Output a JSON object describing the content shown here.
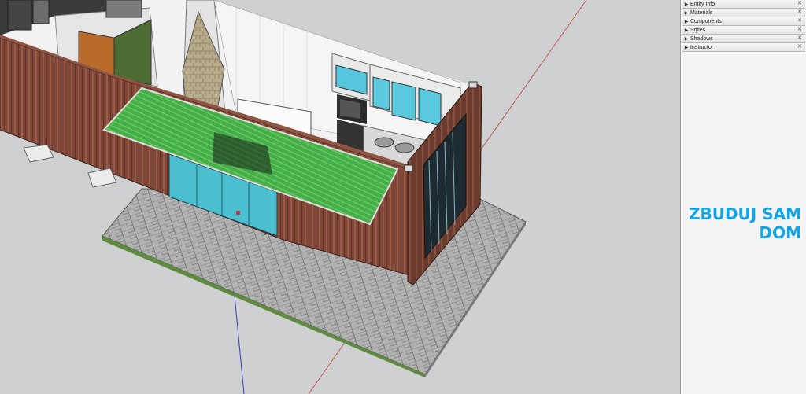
{
  "tray": {
    "items": [
      {
        "label": "Entity Info"
      },
      {
        "label": "Materials"
      },
      {
        "label": "Components"
      },
      {
        "label": "Styles"
      },
      {
        "label": "Shadows"
      },
      {
        "label": "Instructor"
      }
    ],
    "expand_icon": "triangle-right-icon",
    "close_icon": "close-icon"
  },
  "watermark": {
    "line1": "ZBUDUJ SAM",
    "line2": "DOM",
    "color": "#11a5e6"
  },
  "scene": {
    "description_colors": {
      "container_wall": "#7a4536",
      "awning_glass": "#3fbf4a",
      "window_glass": "#4cc3d6",
      "paving": "#a9aaa9",
      "kitchen_cabinet": "#e8e8e8"
    }
  }
}
